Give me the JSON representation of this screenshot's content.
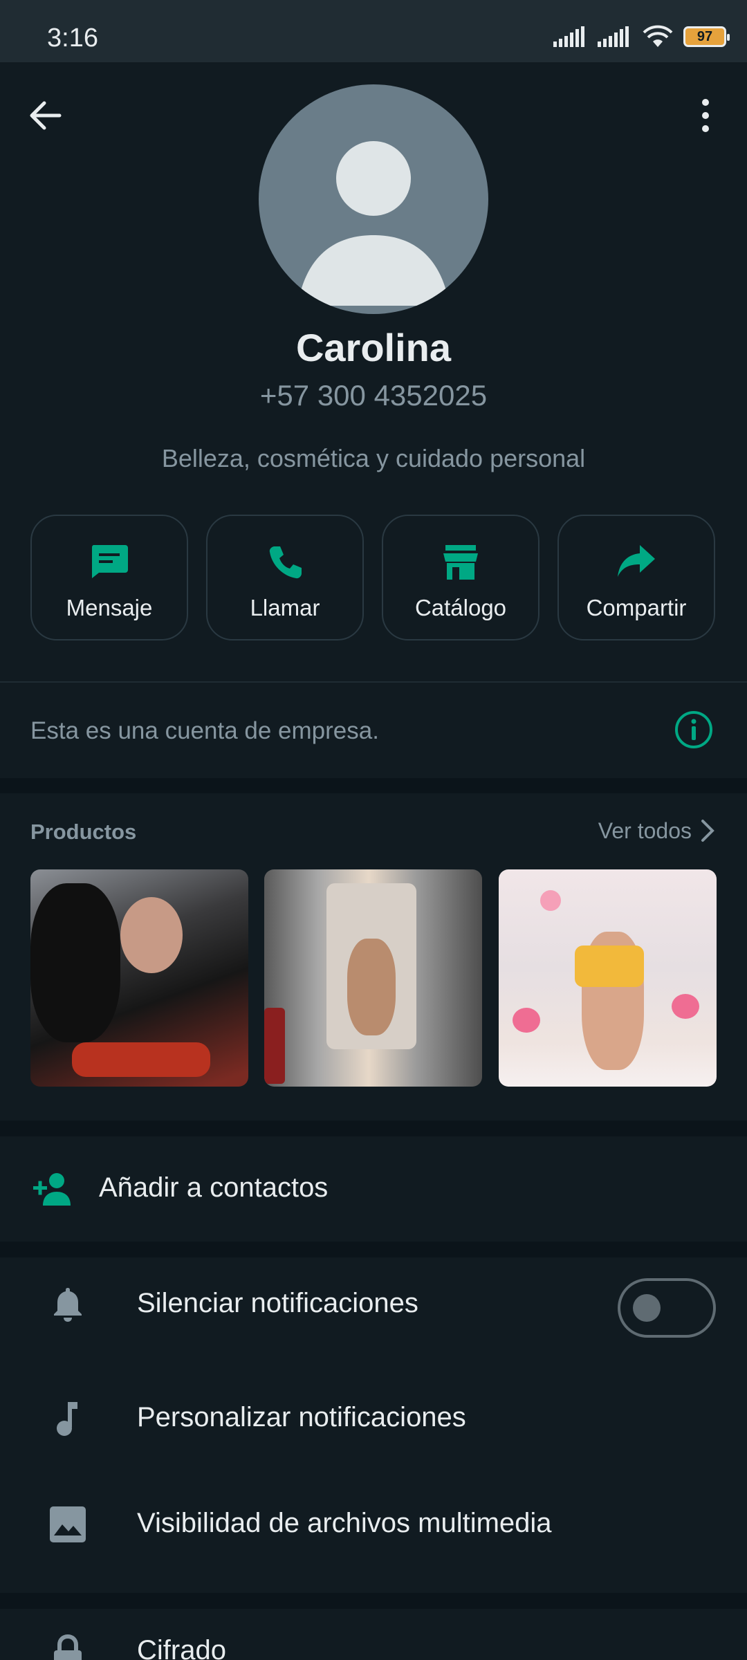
{
  "status_bar": {
    "time": "3:16",
    "battery": "97",
    "icons": [
      "signal-icon",
      "signal-icon",
      "wifi-icon",
      "battery-icon"
    ]
  },
  "header": {
    "back_icon": "arrow-left-icon",
    "menu_icon": "more-vertical-icon"
  },
  "profile": {
    "name": "Carolina",
    "phone": "+57 300 4352025",
    "category": "Belleza, cosmética y cuidado personal"
  },
  "actions": [
    {
      "label": "Mensaje",
      "icon": "message-icon"
    },
    {
      "label": "Llamar",
      "icon": "phone-icon"
    },
    {
      "label": "Catálogo",
      "icon": "store-icon"
    },
    {
      "label": "Compartir",
      "icon": "share-icon"
    }
  ],
  "business_note": "Esta es una cuenta de empresa.",
  "products": {
    "title": "Productos",
    "see_all": "Ver todos"
  },
  "add_contact": "Añadir a contactos",
  "settings": [
    {
      "label": "Silenciar notificaciones",
      "icon": "bell-icon",
      "toggle": false
    },
    {
      "label": "Personalizar notificaciones",
      "icon": "music-note-icon"
    },
    {
      "label": "Visibilidad de archivos multimedia",
      "icon": "image-icon"
    }
  ],
  "encryption": "Cifrado",
  "colors": {
    "background": "#111b21",
    "accent": "#00a884",
    "secondary_text": "#8696a0"
  }
}
